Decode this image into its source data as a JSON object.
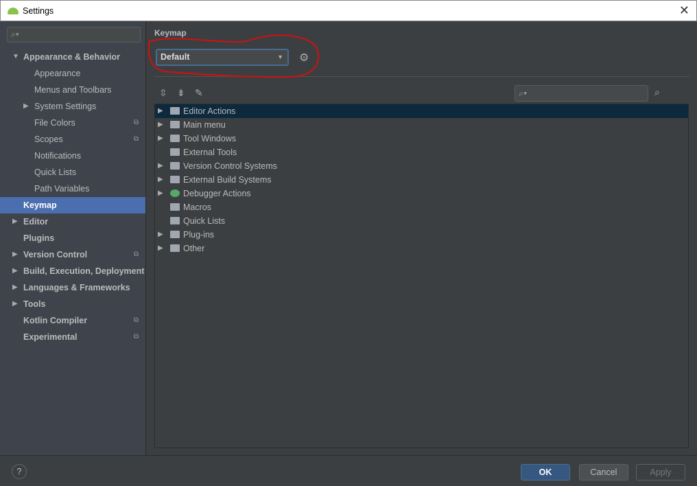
{
  "window": {
    "title": "Settings",
    "close": "✕"
  },
  "sidebar": {
    "search_placeholder": "",
    "items": [
      {
        "label": "Appearance & Behavior",
        "level": 0,
        "arrow": "▼",
        "bold": true
      },
      {
        "label": "Appearance",
        "level": 1
      },
      {
        "label": "Menus and Toolbars",
        "level": 1
      },
      {
        "label": "System Settings",
        "level": 1,
        "arrow": "▶"
      },
      {
        "label": "File Colors",
        "level": 1,
        "copy": true
      },
      {
        "label": "Scopes",
        "level": 1,
        "copy": true
      },
      {
        "label": "Notifications",
        "level": 1
      },
      {
        "label": "Quick Lists",
        "level": 1
      },
      {
        "label": "Path Variables",
        "level": 1
      },
      {
        "label": "Keymap",
        "level": 0,
        "bold": true,
        "selected": true
      },
      {
        "label": "Editor",
        "level": 0,
        "arrow": "▶",
        "bold": true
      },
      {
        "label": "Plugins",
        "level": 0,
        "bold": true
      },
      {
        "label": "Version Control",
        "level": 0,
        "arrow": "▶",
        "bold": true,
        "copy": true
      },
      {
        "label": "Build, Execution, Deployment",
        "level": 0,
        "arrow": "▶",
        "bold": true
      },
      {
        "label": "Languages & Frameworks",
        "level": 0,
        "arrow": "▶",
        "bold": true
      },
      {
        "label": "Tools",
        "level": 0,
        "arrow": "▶",
        "bold": true
      },
      {
        "label": "Kotlin Compiler",
        "level": 0,
        "bold": true,
        "copy": true
      },
      {
        "label": "Experimental",
        "level": 0,
        "bold": true,
        "copy": true
      }
    ]
  },
  "main": {
    "heading": "Keymap",
    "keymap_selected": "Default",
    "tree": [
      {
        "label": "Editor Actions",
        "arrow": true,
        "selected": true
      },
      {
        "label": "Main menu",
        "arrow": true
      },
      {
        "label": "Tool Windows",
        "arrow": true
      },
      {
        "label": "External Tools",
        "arrow": false
      },
      {
        "label": "Version Control Systems",
        "arrow": true
      },
      {
        "label": "External Build Systems",
        "arrow": true
      },
      {
        "label": "Debugger Actions",
        "arrow": true,
        "icon": "bug"
      },
      {
        "label": "Macros",
        "arrow": false
      },
      {
        "label": "Quick Lists",
        "arrow": false
      },
      {
        "label": "Plug-ins",
        "arrow": true
      },
      {
        "label": "Other",
        "arrow": true
      }
    ]
  },
  "footer": {
    "help": "?",
    "ok": "OK",
    "cancel": "Cancel",
    "apply": "Apply"
  }
}
